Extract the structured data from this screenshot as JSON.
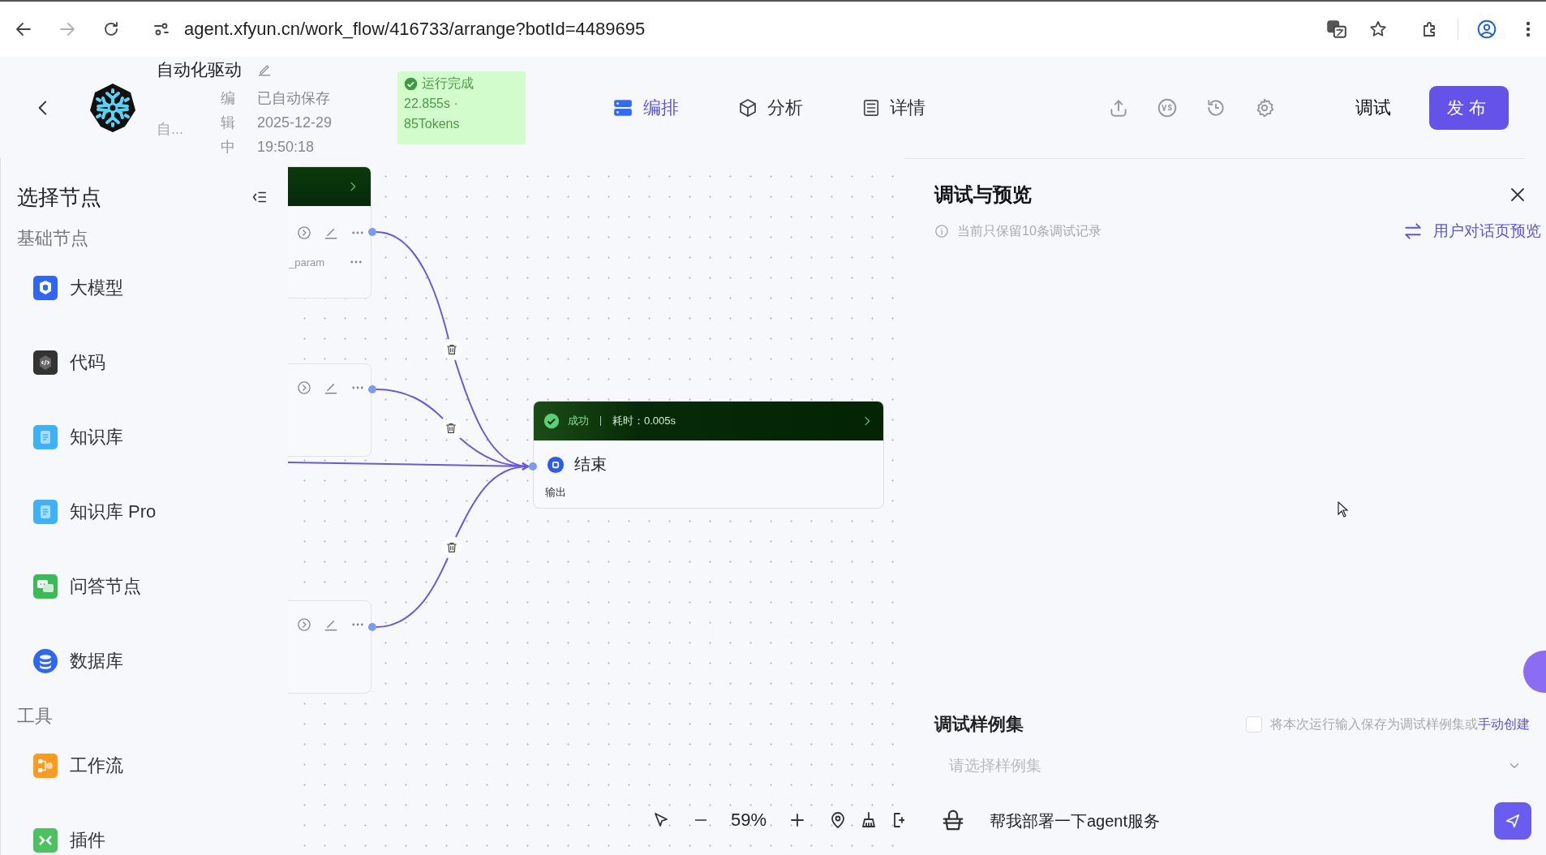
{
  "browser": {
    "url": "agent.xfyun.cn/work_flow/416733/arrange?botId=4489695",
    "forward_disabled": true
  },
  "header": {
    "title": "自动化驱动",
    "subtitle": "自...",
    "edit_state": "编辑中",
    "save_status": "已自动保存",
    "save_date": "2025-12-29",
    "save_time": "19:50:18",
    "run_badge": {
      "status": "运行完成",
      "duration": "22.855s ·",
      "tokens": "85Tokens"
    },
    "tabs": [
      {
        "label": "编排",
        "selected": true
      },
      {
        "label": "分析",
        "selected": false
      },
      {
        "label": "详情",
        "selected": false
      }
    ],
    "debug_button": "调试",
    "publish_button": "发布"
  },
  "sidebar": {
    "title": "选择节点",
    "sections": [
      {
        "title": "基础节点",
        "items": [
          {
            "label": "大模型"
          },
          {
            "label": "代码"
          },
          {
            "label": "知识库"
          },
          {
            "label": "知识库 Pro"
          },
          {
            "label": "问答节点"
          },
          {
            "label": "数据库"
          }
        ]
      },
      {
        "title": "工具",
        "items": [
          {
            "label": "工作流"
          },
          {
            "label": "插件"
          }
        ]
      }
    ]
  },
  "canvas": {
    "nodes": [
      {
        "kind": "run_status",
        "param": "_param"
      },
      {
        "kind": "plain"
      },
      {
        "kind": "plain"
      }
    ],
    "end_node": {
      "status": "成功",
      "time": "耗时：0.005s",
      "title": "结束",
      "output": "输出"
    },
    "zoom": "59%"
  },
  "debug_panel": {
    "title": "调试与预览",
    "notice": "当前只保留10条调试记录",
    "preview_link": "用户对话页预览",
    "sample_title": "调试样例集",
    "save_checkbox": {
      "label": "将本次运行输入保存为调试样例集或",
      "link": "手动创建",
      "checked": false
    },
    "sample_select": {
      "placeholder": "请选择样例集"
    },
    "chat_input": {
      "value": "帮我部署一下agent服务"
    }
  }
}
